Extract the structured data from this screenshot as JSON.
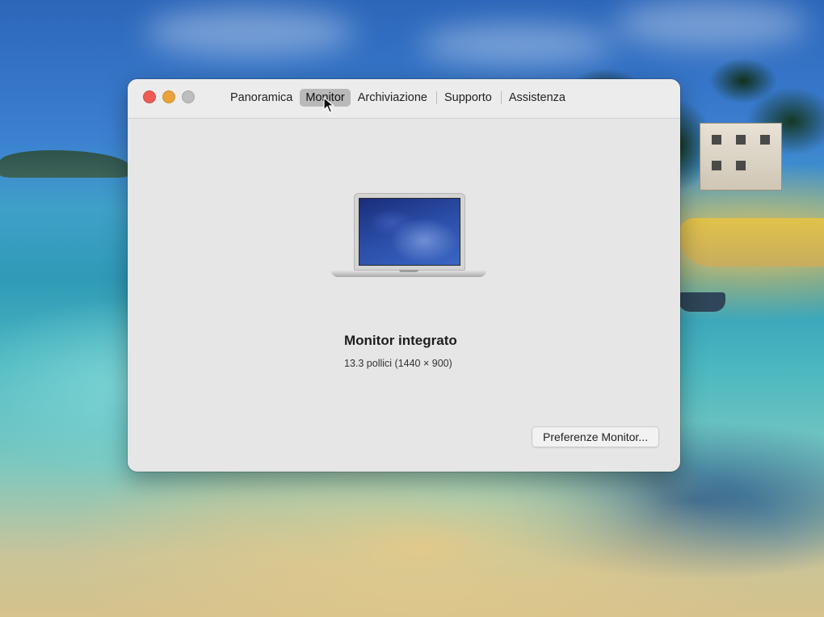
{
  "window": {
    "tabs": [
      {
        "label": "Panoramica"
      },
      {
        "label": "Monitor"
      },
      {
        "label": "Archiviazione"
      },
      {
        "label": "Supporto"
      },
      {
        "label": "Assistenza"
      }
    ],
    "active_tab": "Monitor"
  },
  "main": {
    "display_name": "Monitor integrato",
    "display_size": "13.3 pollici (1440 × 900)",
    "preferences_button": "Preferenze Monitor..."
  },
  "icons": {
    "close": "close-icon",
    "minimize": "minimize-icon",
    "zoom": "zoom-icon",
    "laptop": "laptop-icon",
    "cursor": "cursor-pointer-icon"
  },
  "colors": {
    "close": "#ef5a55",
    "minimize": "#e9a23b",
    "zoom_disabled": "#bdbdbd",
    "window_bg": "#e6e6e6",
    "active_tab_bg": "#b9b9b9"
  }
}
